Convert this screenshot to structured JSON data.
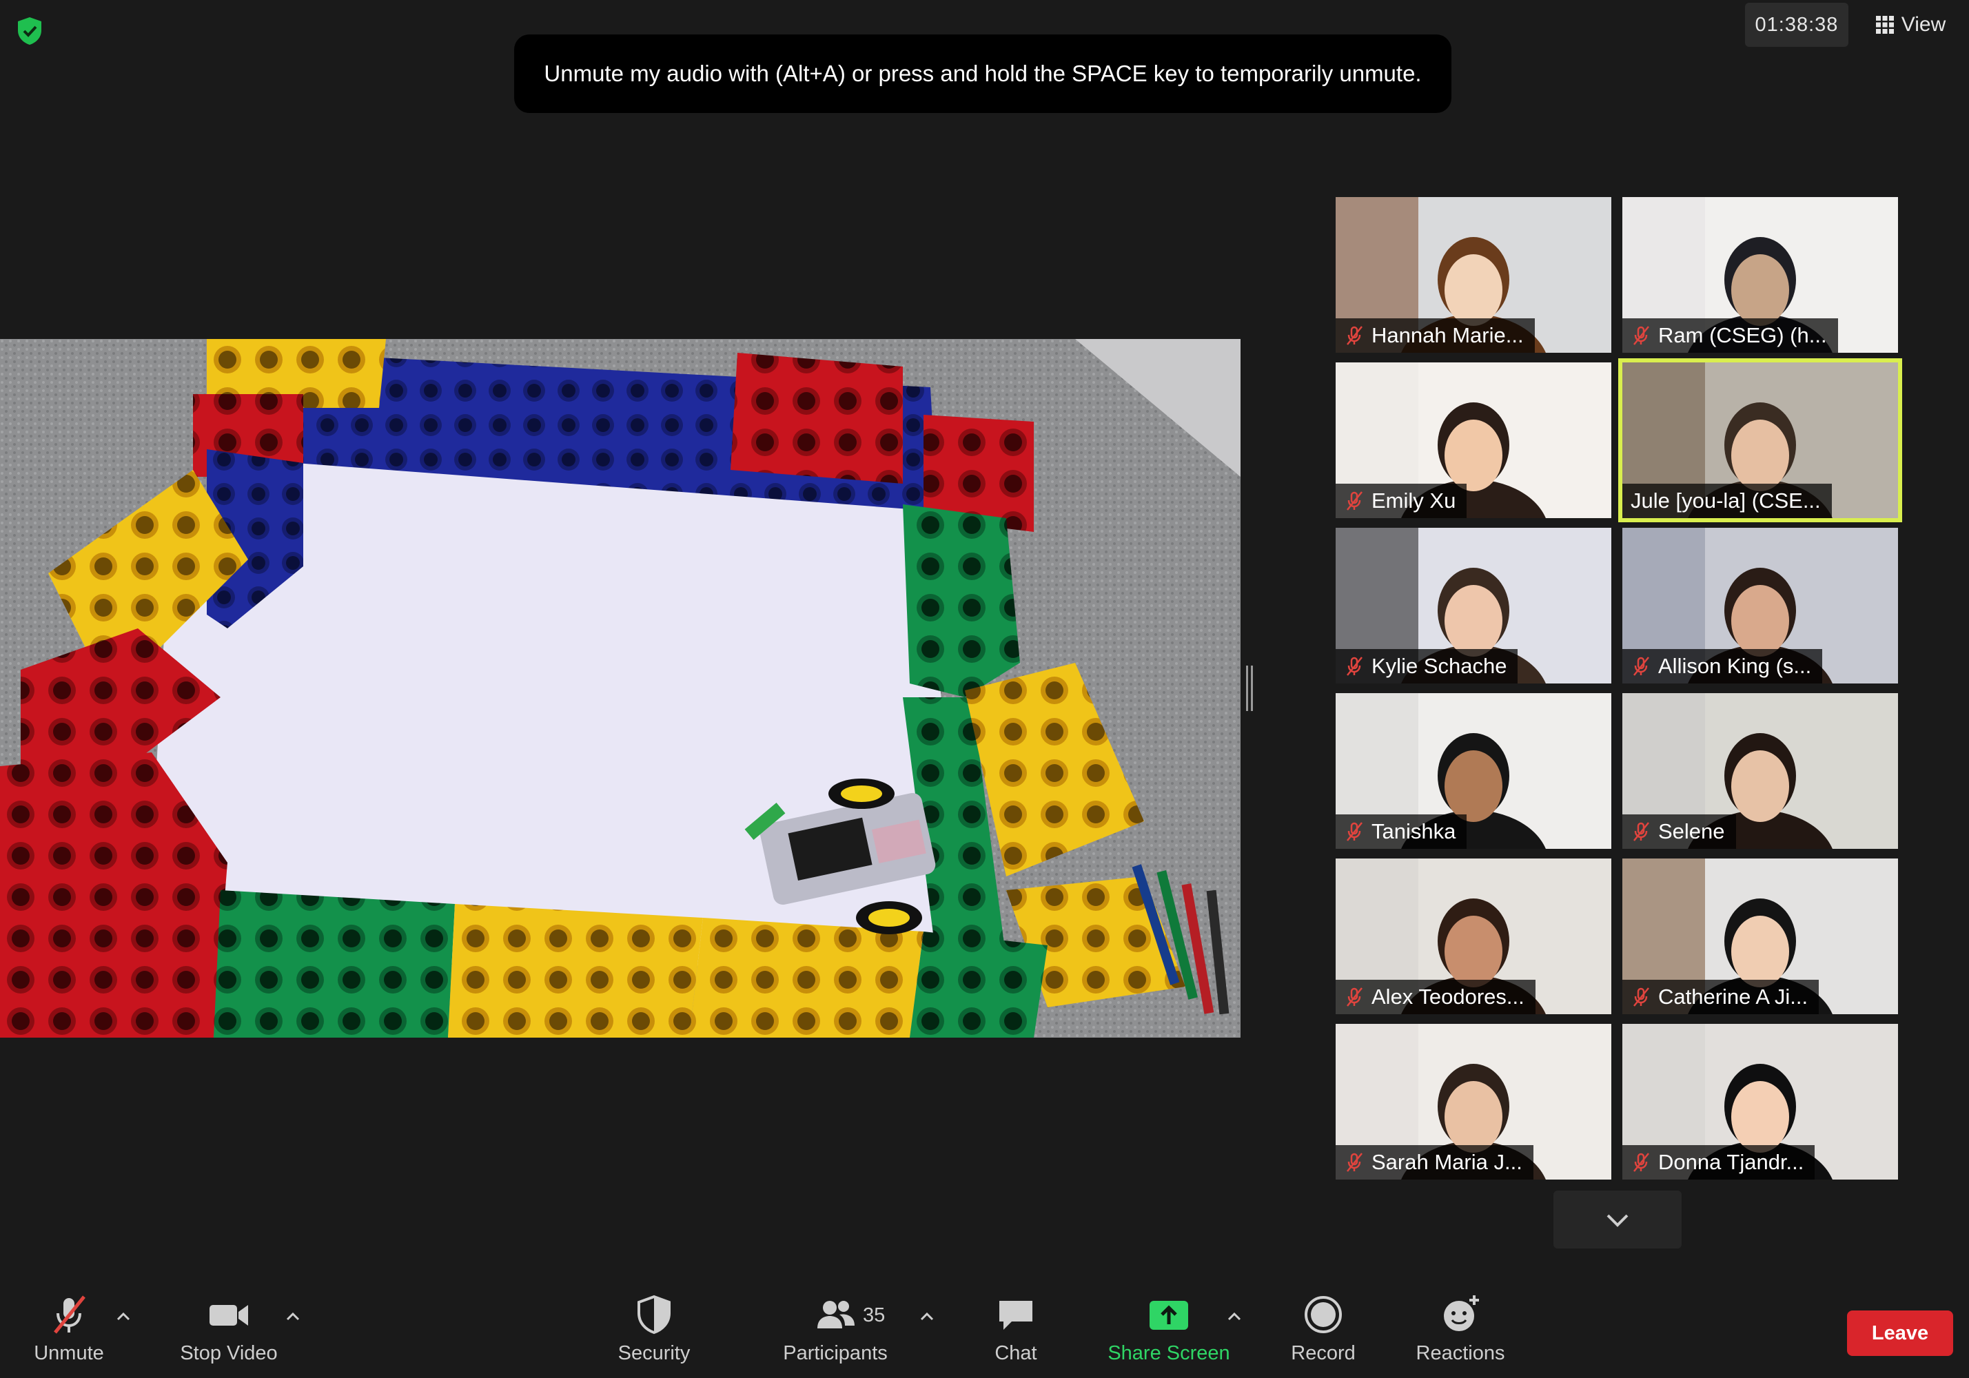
{
  "app": {
    "timer": "01:38:38",
    "view_label": "View",
    "banner": "Unmute my audio with (Alt+A) or press and hold the SPACE key to temporarily unmute."
  },
  "gallery": [
    {
      "name": "Hannah Marie...",
      "muted": true
    },
    {
      "name": "Ram (CSEG) (h...",
      "muted": true
    },
    {
      "name": "Emily Xu",
      "muted": true
    },
    {
      "name": "Jule [you-la] (CSE...",
      "muted": false,
      "active_speaker": true
    },
    {
      "name": "Kylie Schache",
      "muted": true
    },
    {
      "name": "Allison King (s...",
      "muted": true
    },
    {
      "name": "Tanishka",
      "muted": true
    },
    {
      "name": "Selene",
      "muted": true
    },
    {
      "name": "Alex Teodores...",
      "muted": true
    },
    {
      "name": "Catherine A Ji...",
      "muted": true
    },
    {
      "name": "Sarah Maria J...",
      "muted": true
    },
    {
      "name": "Donna Tjandr...",
      "muted": true
    }
  ],
  "toolbar": {
    "unmute": "Unmute",
    "stop_video": "Stop Video",
    "security": "Security",
    "participants": "Participants",
    "participants_count": "35",
    "chat": "Chat",
    "share_screen": "Share Screen",
    "record": "Record",
    "reactions": "Reactions",
    "leave": "Leave"
  },
  "colors": {
    "accent_green": "#2fd565",
    "leave_red": "#d9252b",
    "active_speaker": "#d9ee4e",
    "muted_red": "#e0443e"
  }
}
